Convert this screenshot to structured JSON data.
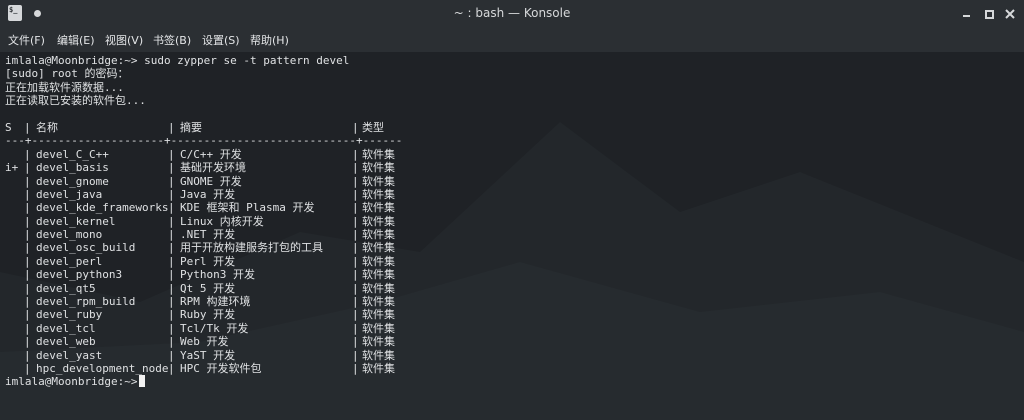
{
  "window": {
    "title": "~ : bash — Konsole",
    "app_icon": "terminal-app-icon",
    "pin_icon": "pin-dot-icon",
    "controls": [
      "minimize-icon",
      "maximize-icon",
      "close-icon"
    ]
  },
  "menu": [
    "文件(F)",
    "编辑(E)",
    "视图(V)",
    "书签(B)",
    "设置(S)",
    "帮助(H)"
  ],
  "terminal": {
    "command_line": "imlala@Moonbridge:~> sudo zypper se -t pattern devel",
    "output_lines": [
      "[sudo] root 的密码：",
      "正在加载软件源数据...",
      "正在读取已安装的软件包..."
    ],
    "table": {
      "headers": {
        "s": "S",
        "sep": "|",
        "name": "名称",
        "summary": "摘要",
        "type": "类型"
      },
      "divider": "---+--------------------+----------------------------+------",
      "rows": [
        {
          "s": "",
          "name": "devel_C_C++",
          "summary": "C/C++ 开发",
          "type": "软件集"
        },
        {
          "s": "i+",
          "name": "devel_basis",
          "summary": "基础开发环境",
          "type": "软件集"
        },
        {
          "s": "",
          "name": "devel_gnome",
          "summary": "GNOME 开发",
          "type": "软件集"
        },
        {
          "s": "",
          "name": "devel_java",
          "summary": "Java 开发",
          "type": "软件集"
        },
        {
          "s": "",
          "name": "devel_kde_frameworks",
          "summary": "KDE 框架和 Plasma 开发",
          "type": "软件集"
        },
        {
          "s": "",
          "name": "devel_kernel",
          "summary": "Linux 内核开发",
          "type": "软件集"
        },
        {
          "s": "",
          "name": "devel_mono",
          "summary": ".NET 开发",
          "type": "软件集"
        },
        {
          "s": "",
          "name": "devel_osc_build",
          "summary": "用于开放构建服务打包的工具",
          "type": "软件集"
        },
        {
          "s": "",
          "name": "devel_perl",
          "summary": "Perl 开发",
          "type": "软件集"
        },
        {
          "s": "",
          "name": "devel_python3",
          "summary": "Python3 开发",
          "type": "软件集"
        },
        {
          "s": "",
          "name": "devel_qt5",
          "summary": "Qt 5 开发",
          "type": "软件集"
        },
        {
          "s": "",
          "name": "devel_rpm_build",
          "summary": "RPM 构建环境",
          "type": "软件集"
        },
        {
          "s": "",
          "name": "devel_ruby",
          "summary": "Ruby 开发",
          "type": "软件集"
        },
        {
          "s": "",
          "name": "devel_tcl",
          "summary": "Tcl/Tk 开发",
          "type": "软件集"
        },
        {
          "s": "",
          "name": "devel_web",
          "summary": "Web 开发",
          "type": "软件集"
        },
        {
          "s": "",
          "name": "devel_yast",
          "summary": "YaST 开发",
          "type": "软件集"
        },
        {
          "s": "",
          "name": "hpc_development_node",
          "summary": "HPC 开发软件包",
          "type": "软件集"
        }
      ]
    },
    "prompt": "imlala@Moonbridge:~>"
  },
  "colors": {
    "titlebar_bg": "#2b2f33",
    "terminal_bg": "#1f2226",
    "text": "#dfe1e3"
  }
}
